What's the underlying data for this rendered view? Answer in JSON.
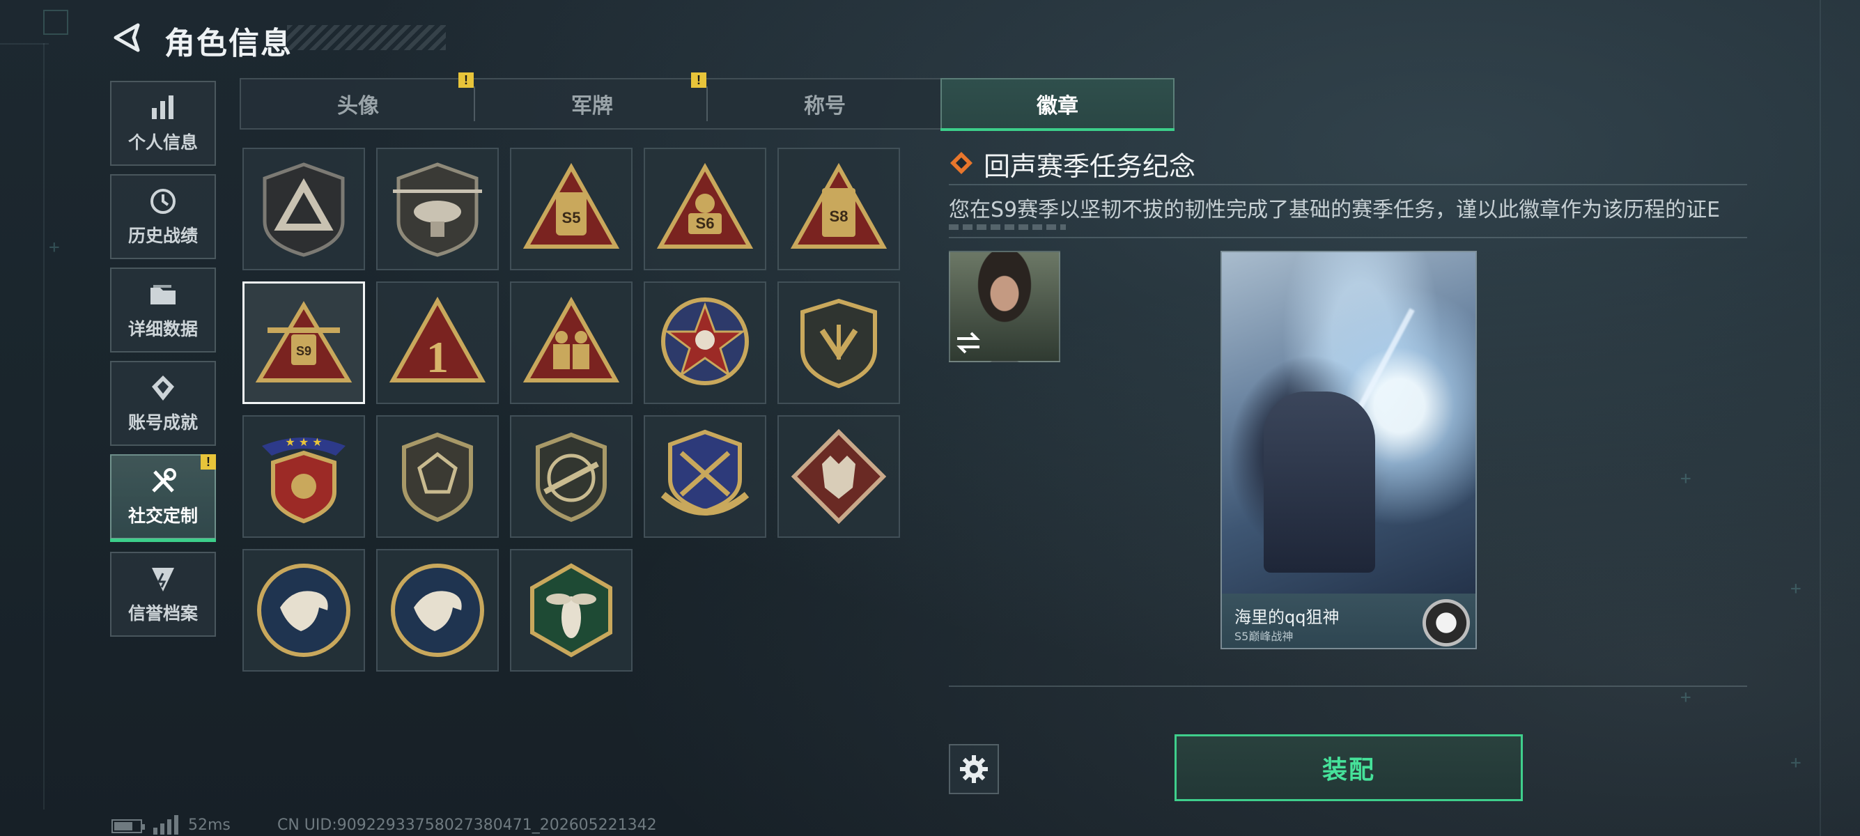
{
  "header": {
    "title": "角色信息",
    "back_icon": "back-chevron-icon"
  },
  "sidebar": {
    "items": [
      {
        "label": "个人信息",
        "icon": "bar-chart-icon",
        "active": false,
        "alert": false
      },
      {
        "label": "历史战绩",
        "icon": "history-clock-icon",
        "active": false,
        "alert": false
      },
      {
        "label": "详细数据",
        "icon": "folder-icon",
        "active": false,
        "alert": false
      },
      {
        "label": "账号成就",
        "icon": "achievement-badge-icon",
        "active": false,
        "alert": false
      },
      {
        "label": "社交定制",
        "icon": "tools-icon",
        "active": true,
        "alert": true
      },
      {
        "label": "信誉档案",
        "icon": "credit-shield-icon",
        "active": false,
        "alert": false
      }
    ]
  },
  "tabs": [
    {
      "label": "头像",
      "alert": true,
      "active": false
    },
    {
      "label": "军牌",
      "alert": true,
      "active": false
    },
    {
      "label": "称号",
      "alert": false,
      "active": false
    },
    {
      "label": "徽章",
      "alert": false,
      "active": true
    }
  ],
  "alert_mark": "!",
  "badges": [
    {
      "name": "triangle-emblem-badge",
      "selected": false
    },
    {
      "name": "helicopter-badge",
      "selected": false
    },
    {
      "name": "s5-season-badge",
      "selected": false
    },
    {
      "name": "s6-season-badge",
      "selected": false
    },
    {
      "name": "s8-season-badge",
      "selected": false
    },
    {
      "name": "s9-season-badge",
      "selected": true
    },
    {
      "name": "number-one-badge",
      "selected": false
    },
    {
      "name": "soldiers-badge",
      "selected": false
    },
    {
      "name": "star-skull-badge",
      "selected": false
    },
    {
      "name": "shield-wing-badge",
      "selected": false
    },
    {
      "name": "three-star-crest-badge",
      "selected": false
    },
    {
      "name": "geometric-shield-badge",
      "selected": false
    },
    {
      "name": "rifle-shield-badge",
      "selected": false
    },
    {
      "name": "crossed-sword-crest-badge",
      "selected": false
    },
    {
      "name": "wolf-diamond-badge",
      "selected": false
    },
    {
      "name": "eagle-round-badge-1",
      "selected": false
    },
    {
      "name": "eagle-round-badge-2",
      "selected": false
    },
    {
      "name": "wasp-hexagon-badge",
      "selected": false
    }
  ],
  "detail": {
    "title": "回声赛季任务纪念",
    "description": "您在S9赛季以坚韧不拔的韧性完成了基础的赛季任务，谨以此徽章作为该历程的证E",
    "icon": "diamond-badge-icon"
  },
  "card": {
    "player_name": "海里的qq狙神",
    "subtitle": "S5巅峰战神"
  },
  "actions": {
    "settings_icon": "gear-icon",
    "equip_label": "装配"
  },
  "status_bar": {
    "ping": "52ms",
    "uid": "CN UID:909229337580273804​71_202605221342"
  },
  "colors": {
    "accent_green": "#3ccf8a",
    "alert_yellow": "#e8c43a",
    "badge_gold": "#c9a85c",
    "badge_red": "#7a2320"
  }
}
